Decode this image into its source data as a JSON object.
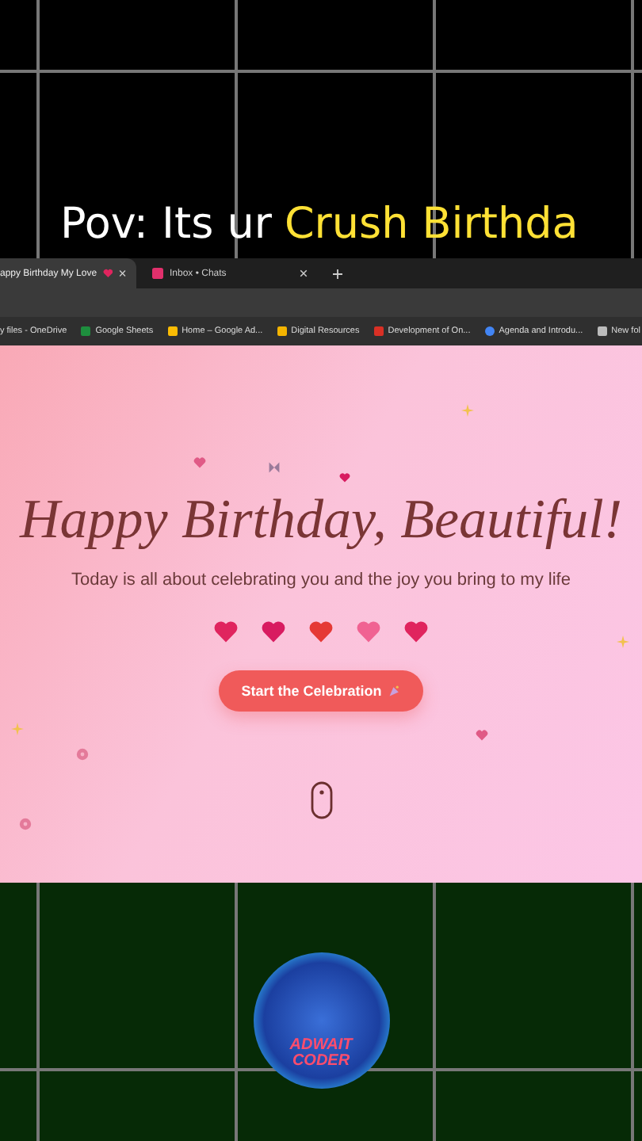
{
  "caption": {
    "lead": "Pov: Its ur",
    "highlight": "Crush Birthda"
  },
  "tabs": [
    {
      "label": "appy Birthday My Love",
      "selected": true
    },
    {
      "label": "Inbox • Chats",
      "selected": false
    }
  ],
  "bookmarks": [
    {
      "label": "y files - OneDrive"
    },
    {
      "label": "Google Sheets",
      "kind": "sheets"
    },
    {
      "label": "Home – Google Ad...",
      "kind": "ads"
    },
    {
      "label": "Digital Resources",
      "kind": "doc"
    },
    {
      "label": "Development of On...",
      "kind": "red"
    },
    {
      "label": "Agenda and Introdu...",
      "kind": "circle"
    },
    {
      "label": "New fol",
      "kind": "folder"
    }
  ],
  "page": {
    "title": "Happy Birthday, Beautiful!",
    "subtitle": "Today is all about celebrating you and the joy you bring to my life",
    "button": "Start the Celebration"
  },
  "logo": {
    "line1": "ADWAIT",
    "line2": "CODER"
  }
}
